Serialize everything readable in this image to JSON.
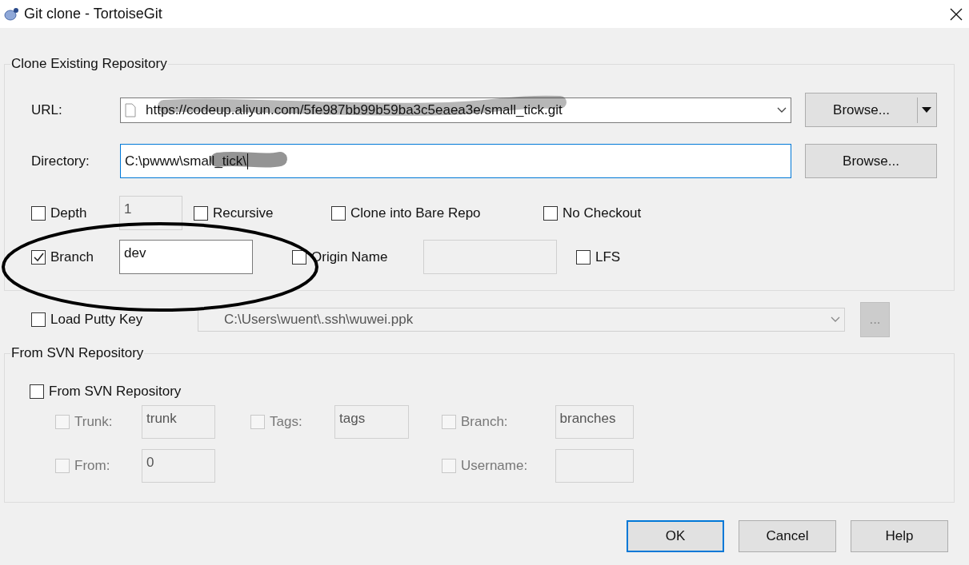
{
  "window": {
    "title": "Git clone - TortoiseGit"
  },
  "clone_group": {
    "title": "Clone Existing Repository",
    "url": {
      "label": "URL:",
      "value": "https://codeup.aliyun.com/5fe987bb99b59ba3c5eaea3e/small_tick.git",
      "browse": "Browse..."
    },
    "directory": {
      "label": "Directory:",
      "value": "C:\\pwww\\small_tick\\",
      "focused": true,
      "browse": "Browse..."
    },
    "depth": {
      "label": "Depth",
      "checked": false,
      "value": "1",
      "disabled": true
    },
    "recursive": {
      "label": "Recursive",
      "checked": false
    },
    "bare": {
      "label": "Clone into Bare Repo",
      "checked": false
    },
    "no_checkout": {
      "label": "No Checkout",
      "checked": false
    },
    "branch": {
      "label": "Branch",
      "checked": true,
      "value": "dev",
      "disabled": false
    },
    "origin_name": {
      "label": "Origin Name",
      "checked": false,
      "disabled": true
    },
    "lfs": {
      "label": "LFS",
      "checked": false
    }
  },
  "putty": {
    "label": "Load Putty Key",
    "checked": false,
    "value": "C:\\Users\\wuent\\.ssh\\wuwei.ppk",
    "disabled": true,
    "button": "..."
  },
  "svn_group": {
    "title": "From SVN Repository",
    "enable": {
      "label": "From SVN Repository",
      "checked": false
    },
    "fields": [
      {
        "label": "Trunk:",
        "checked": false,
        "value": "trunk",
        "disabled": true
      },
      {
        "label": "Tags:",
        "checked": false,
        "value": "tags",
        "disabled": true
      },
      {
        "label": "Branch:",
        "checked": false,
        "value": "branches",
        "disabled": true
      },
      {
        "label": "From:",
        "checked": false,
        "value": "0",
        "disabled": true
      },
      {
        "label": "Username:",
        "checked": false,
        "disabled": true
      }
    ]
  },
  "buttons": [
    {
      "label": "OK",
      "default": true
    },
    {
      "label": "Cancel",
      "default": false
    },
    {
      "label": "Help",
      "default": false
    }
  ]
}
